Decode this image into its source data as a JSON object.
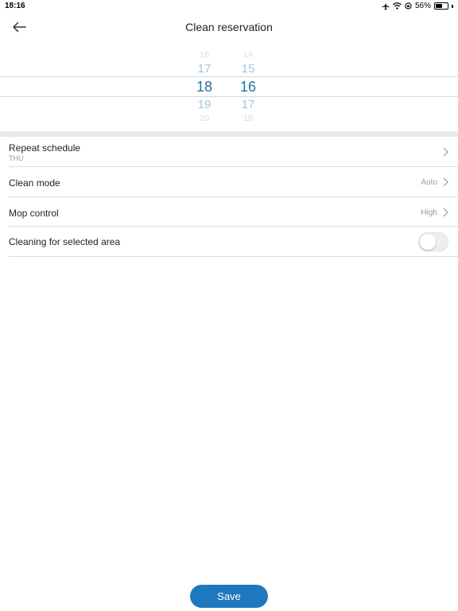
{
  "status_bar": {
    "time": "18:16",
    "battery_percent": "56%",
    "battery_level": 0.56
  },
  "nav": {
    "title": "Clean reservation"
  },
  "time_picker": {
    "hours": [
      "16",
      "17",
      "18",
      "19",
      "20"
    ],
    "minutes": [
      "14",
      "15",
      "16",
      "17",
      "18"
    ],
    "selected_hour": "18",
    "selected_minute": "16"
  },
  "settings": {
    "repeat_schedule": {
      "label": "Repeat schedule",
      "value": "THU"
    },
    "clean_mode": {
      "label": "Clean mode",
      "value": "Auto"
    },
    "mop_control": {
      "label": "Mop control",
      "value": "High"
    },
    "selected_area": {
      "label": "Cleaning for selected area",
      "enabled": false
    }
  },
  "footer": {
    "save_label": "Save"
  },
  "colors": {
    "accent": "#1e78bd",
    "picker_text": "#2a7fb3"
  }
}
